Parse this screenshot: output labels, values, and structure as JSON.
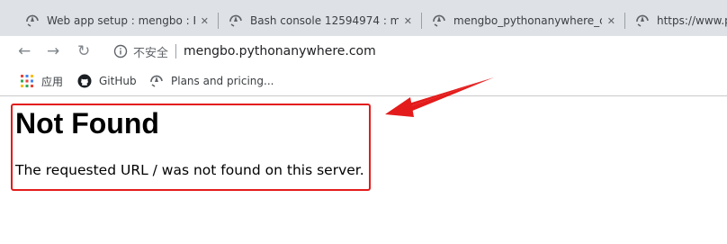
{
  "tabs": [
    {
      "title": "Web app setup : mengbo : P",
      "icon": "pythonanywhere-icon"
    },
    {
      "title": "Bash console 12594974 : me",
      "icon": "pythonanywhere-icon"
    },
    {
      "title": "mengbo_pythonanywhere_c",
      "icon": "pythonanywhere-icon"
    },
    {
      "title": "https://www.py",
      "icon": "pythonanywhere-icon"
    }
  ],
  "address_bar": {
    "security_label": "不安全",
    "url": "mengbo.pythonanywhere.com"
  },
  "bookmarks": [
    {
      "label": "应用",
      "icon": "apps-grid-icon"
    },
    {
      "label": "GitHub",
      "icon": "github-icon"
    },
    {
      "label": "Plans and pricing...",
      "icon": "pythonanywhere-icon"
    }
  ],
  "page": {
    "heading": "Not Found",
    "message": "The requested URL / was not found on this server."
  },
  "colors": {
    "annotation_red": "#e41b1b",
    "tabstrip_bg": "#dee1e6"
  }
}
